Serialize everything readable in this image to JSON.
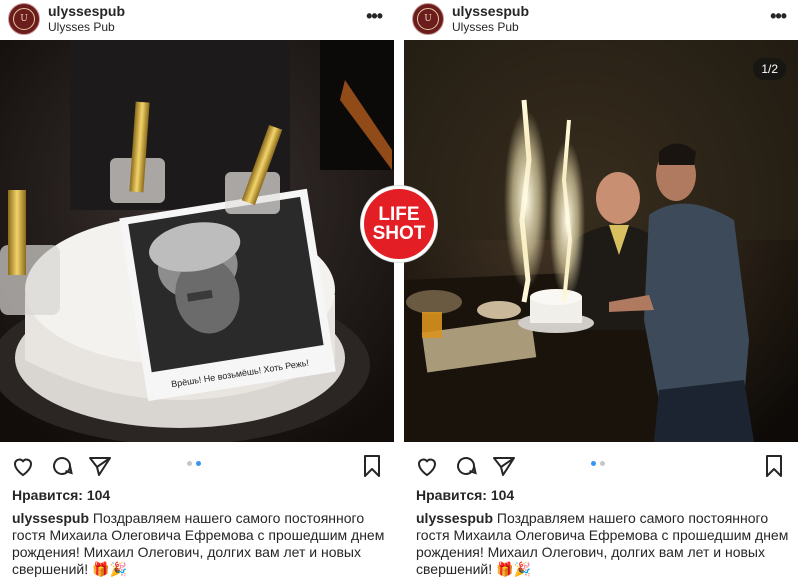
{
  "watermark": {
    "line1": "LIFE",
    "line2": "SHOT"
  },
  "posts": [
    {
      "username": "ulyssespub",
      "location": "Ulysses Pub",
      "avatar_text": "U",
      "photo_text": "Врёшь! Не возьмёшь! Хоть Режь!",
      "counter": "",
      "likes": "Нравится: 104",
      "caption_user": "ulyssespub",
      "caption_text": "Поздравляем нашего самого постоянного гостя Михаила Олеговича Ефремова с  прошедшим днем рождения! Михаил Олегович, долгих вам лет и новых свершений! 🎁🎉",
      "active_dot": 1
    },
    {
      "username": "ulyssespub",
      "location": "Ulysses Pub",
      "avatar_text": "U",
      "photo_text": "",
      "counter": "1/2",
      "likes": "Нравится: 104",
      "caption_user": "ulyssespub",
      "caption_text": "Поздравляем нашего самого постоянного гостя Михаила Олеговича Ефремова с  прошедшим днем рождения! Михаил Олегович, долгих вам лет и новых свершений! 🎁🎉",
      "active_dot": 0
    }
  ],
  "icons": [
    "heart-icon",
    "comment-icon",
    "share-icon",
    "bookmark-icon",
    "more-icon"
  ],
  "colors": {
    "accent": "#3897f0",
    "watermark": "#e31e24",
    "avatar": "#6b1d1d"
  }
}
